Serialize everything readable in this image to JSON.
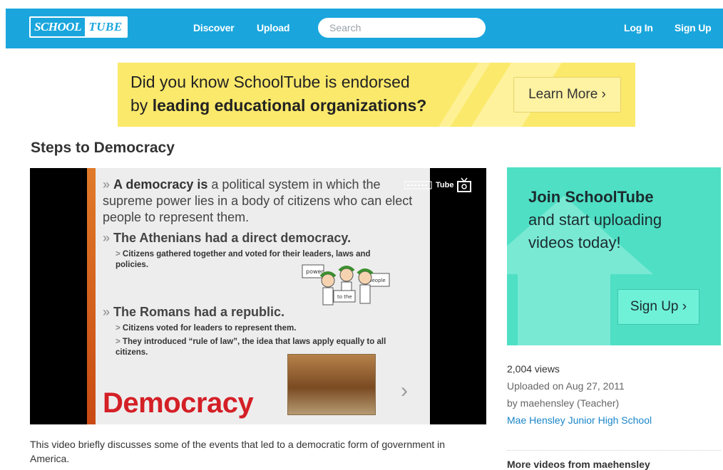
{
  "header": {
    "logo_part1": "SCHOOL",
    "logo_part2": "TUBE",
    "nav": {
      "discover": "Discover",
      "upload": "Upload"
    },
    "search_placeholder": "Search",
    "login": "Log In",
    "signup": "Sign Up"
  },
  "banner": {
    "line1": "Did you know SchoolTube is endorsed",
    "line2_prefix": "by ",
    "line2_bold": "leading educational organizations?",
    "button": "Learn More ›"
  },
  "video": {
    "title": "Steps to Democracy",
    "slide": {
      "b1_bold": "A democracy is",
      "b1_rest": " a political system in which the supreme power lies in a body of citizens who can elect people to represent them.",
      "b2": "The Athenians had a direct democracy.",
      "b2_sub": "Citizens gathered together and voted for their leaders, laws and policies.",
      "b3": "The Romans had a republic.",
      "b3_sub1": "Citizens voted for leaders to represent them.",
      "b3_sub2": "They introduced “rule of law”, the idea that laws apply equally to all citizens.",
      "big_word": "Democracy",
      "sign1": "power",
      "sign2": "to the",
      "sign3": "people"
    },
    "watermark": "Tube",
    "description": "This video briefly discusses some of the events that led to a democratic form of government in America."
  },
  "sidebar": {
    "join_line1": "Join SchoolTube",
    "join_line2": "and start uploading",
    "join_line3": "videos today!",
    "signup_button": "Sign Up ›",
    "views": "2,004 views",
    "uploaded": "Uploaded on Aug 27, 2011",
    "by": "by maehensley (Teacher)",
    "school": "Mae Hensley Junior High School",
    "more_videos": "More videos from maehensley"
  },
  "colors": {
    "header_blue": "#1aa6dd",
    "banner_yellow": "#fbe96b",
    "join_teal": "#4fdfc4",
    "democracy_red": "#d41f26",
    "link_blue": "#1a86c8"
  }
}
